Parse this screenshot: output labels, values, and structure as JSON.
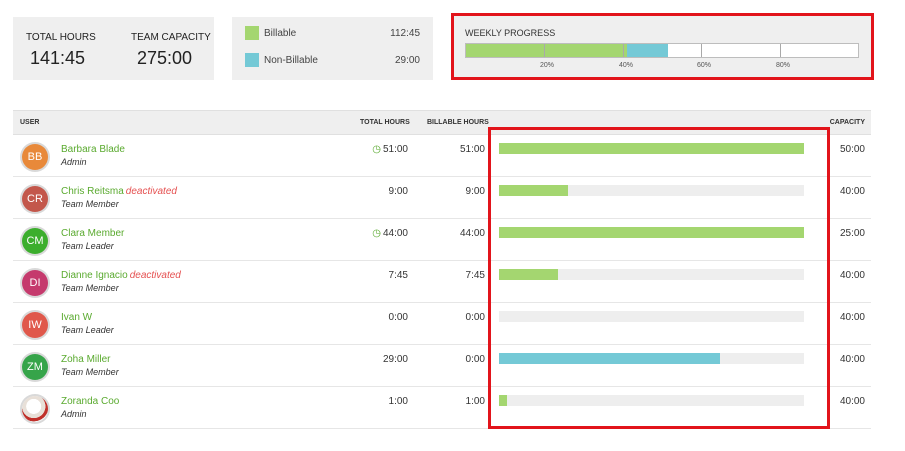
{
  "summary": {
    "total_hours_label": "TOTAL HOURS",
    "total_hours_value": "141:45",
    "team_capacity_label": "TEAM CAPACITY",
    "team_capacity_value": "275:00"
  },
  "legend": {
    "billable_label": "Billable",
    "billable_hours": "112:45",
    "billable_color": "#a4d670",
    "nonbillable_label": "Non-Billable",
    "nonbillable_hours": "29:00",
    "nonbillable_color": "#74c9d6"
  },
  "weekly_progress": {
    "title": "WEEKLY PROGRESS",
    "billable_percent": 41,
    "nonbillable_percent": 10.5,
    "ticks": [
      "20%",
      "40%",
      "60%",
      "80%"
    ]
  },
  "table": {
    "headers": {
      "user": "USER",
      "total_hours": "TOTAL HOURS",
      "billable_hours": "BILLABLE HOURS",
      "capacity": "CAPACITY"
    },
    "rows": [
      {
        "initials": "BB",
        "avatar_color": "#e8893a",
        "name": "Barbara Blade",
        "deactivated": "",
        "role": "Admin",
        "clock_icon": "clock-icon",
        "total": "51:00",
        "billable": "51:00",
        "capacity": "50:00",
        "progress_percent": 100,
        "progress_color": "#a4d670"
      },
      {
        "initials": "CR",
        "avatar_color": "#c3574b",
        "name": "Chris Reitsma",
        "deactivated": "deactivated",
        "role": "Team Member",
        "clock_icon": "",
        "total": "9:00",
        "billable": "9:00",
        "capacity": "40:00",
        "progress_percent": 22.5,
        "progress_color": "#a4d670"
      },
      {
        "initials": "CM",
        "avatar_color": "#3cae2d",
        "name": "Clara Member",
        "deactivated": "",
        "role": "Team Leader",
        "clock_icon": "clock-icon",
        "total": "44:00",
        "billable": "44:00",
        "capacity": "25:00",
        "progress_percent": 100,
        "progress_color": "#a4d670"
      },
      {
        "initials": "DI",
        "avatar_color": "#c53a6d",
        "name": "Dianne Ignacio",
        "deactivated": "deactivated",
        "role": "Team Member",
        "clock_icon": "",
        "total": "7:45",
        "billable": "7:45",
        "capacity": "40:00",
        "progress_percent": 19.4,
        "progress_color": "#a4d670"
      },
      {
        "initials": "IW",
        "avatar_color": "#e0584b",
        "name": "Ivan W",
        "deactivated": "",
        "role": "Team Leader",
        "clock_icon": "",
        "total": "0:00",
        "billable": "0:00",
        "capacity": "40:00",
        "progress_percent": 0,
        "progress_color": "#a4d670"
      },
      {
        "initials": "ZM",
        "avatar_color": "#36a44a",
        "name": "Zoha Miller",
        "deactivated": "",
        "role": "Team Member",
        "clock_icon": "",
        "total": "29:00",
        "billable": "0:00",
        "capacity": "40:00",
        "progress_percent": 72.5,
        "progress_color": "#74c9d6"
      },
      {
        "initials": "",
        "avatar_color": "#d9d9d9",
        "name": "Zoranda Coo",
        "deactivated": "",
        "role": "Admin",
        "clock_icon": "",
        "total": "1:00",
        "billable": "1:00",
        "capacity": "40:00",
        "progress_percent": 2.5,
        "progress_color": "#a4d670"
      }
    ]
  },
  "highlight_color": "#e2141b"
}
